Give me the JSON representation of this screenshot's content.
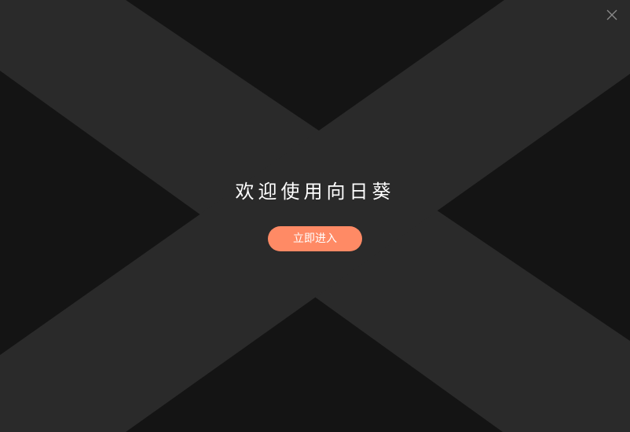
{
  "window": {
    "close_icon": "close-icon"
  },
  "welcome": {
    "title": "欢迎使用向日葵",
    "enter_label": "立即进入"
  },
  "colors": {
    "background": "#141414",
    "x_band": "#2a2a2a",
    "accent": "#ff8a65",
    "text": "#ffffff",
    "close_icon": "#8a8a8a"
  }
}
